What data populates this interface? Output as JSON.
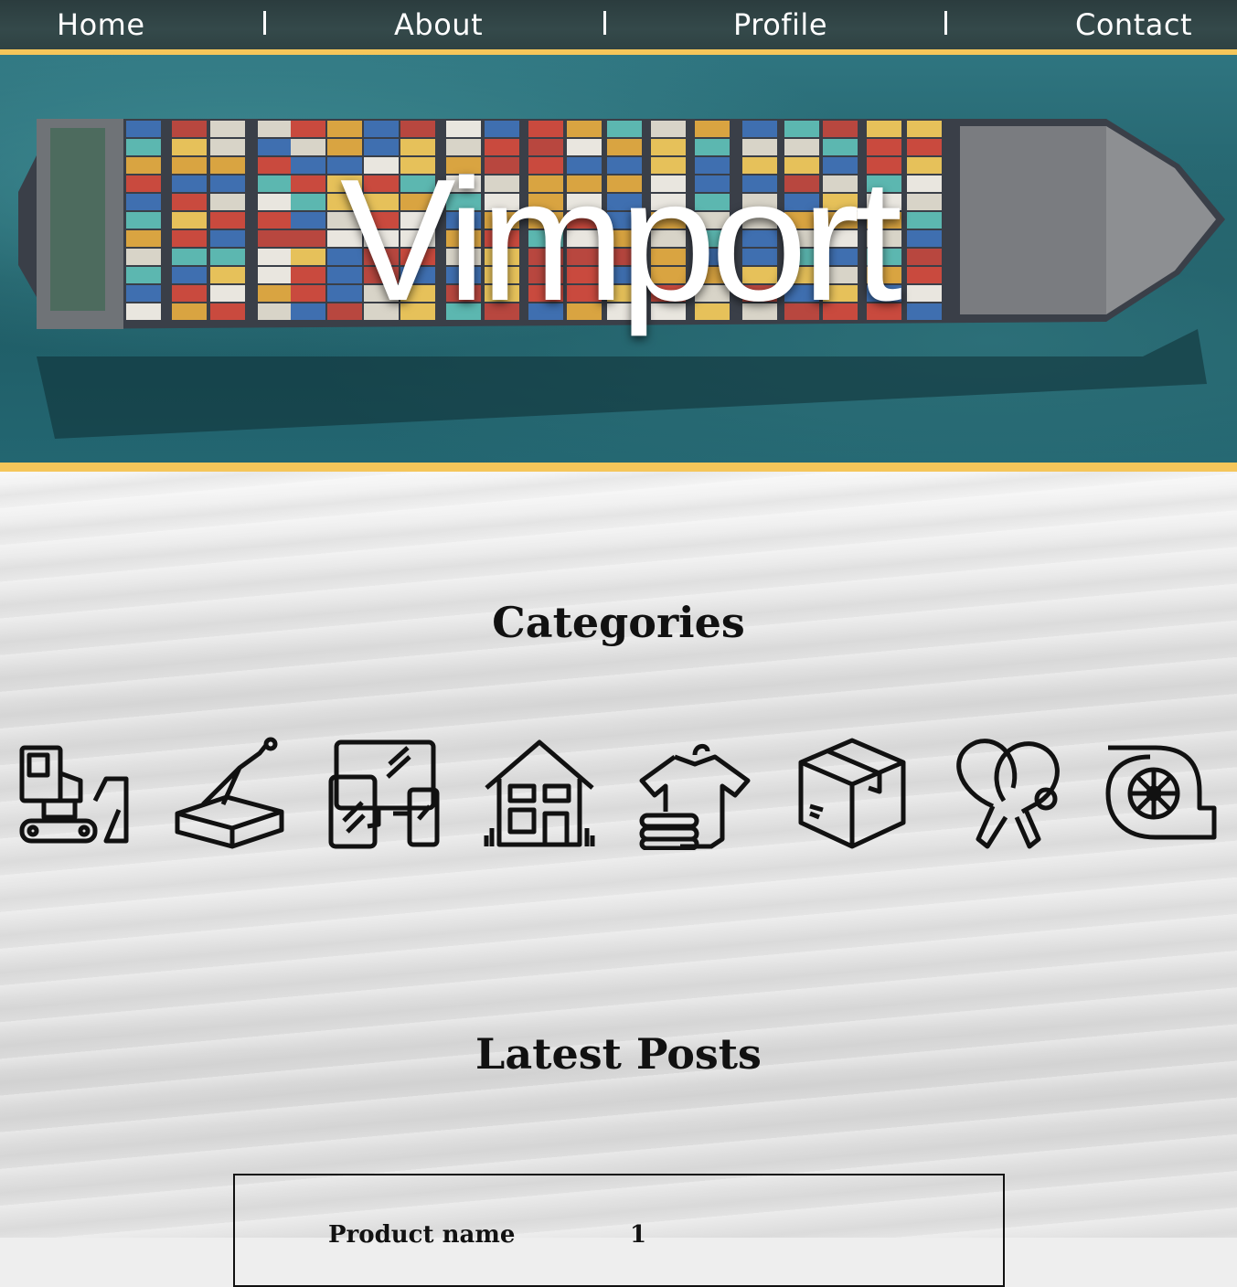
{
  "nav": {
    "items": [
      {
        "label": "Home"
      },
      {
        "label": "About"
      },
      {
        "label": "Profile"
      },
      {
        "label": "Contact"
      }
    ],
    "separator": "|"
  },
  "hero": {
    "title": "Vimport"
  },
  "categories": {
    "title": "Categories",
    "icons": [
      "excavator-icon",
      "brick-trowel-icon",
      "devices-icon",
      "house-icon",
      "clothing-icon",
      "box-icon",
      "ping-pong-icon",
      "turbo-icon"
    ]
  },
  "latest_posts": {
    "title": "Latest Posts",
    "table": {
      "header_label": "Product name",
      "header_value": "1"
    }
  },
  "colors": {
    "accent": "#f5c65a",
    "nav_bg": "#34494a",
    "sea": "#1f5b64",
    "text_dark": "#111111"
  }
}
